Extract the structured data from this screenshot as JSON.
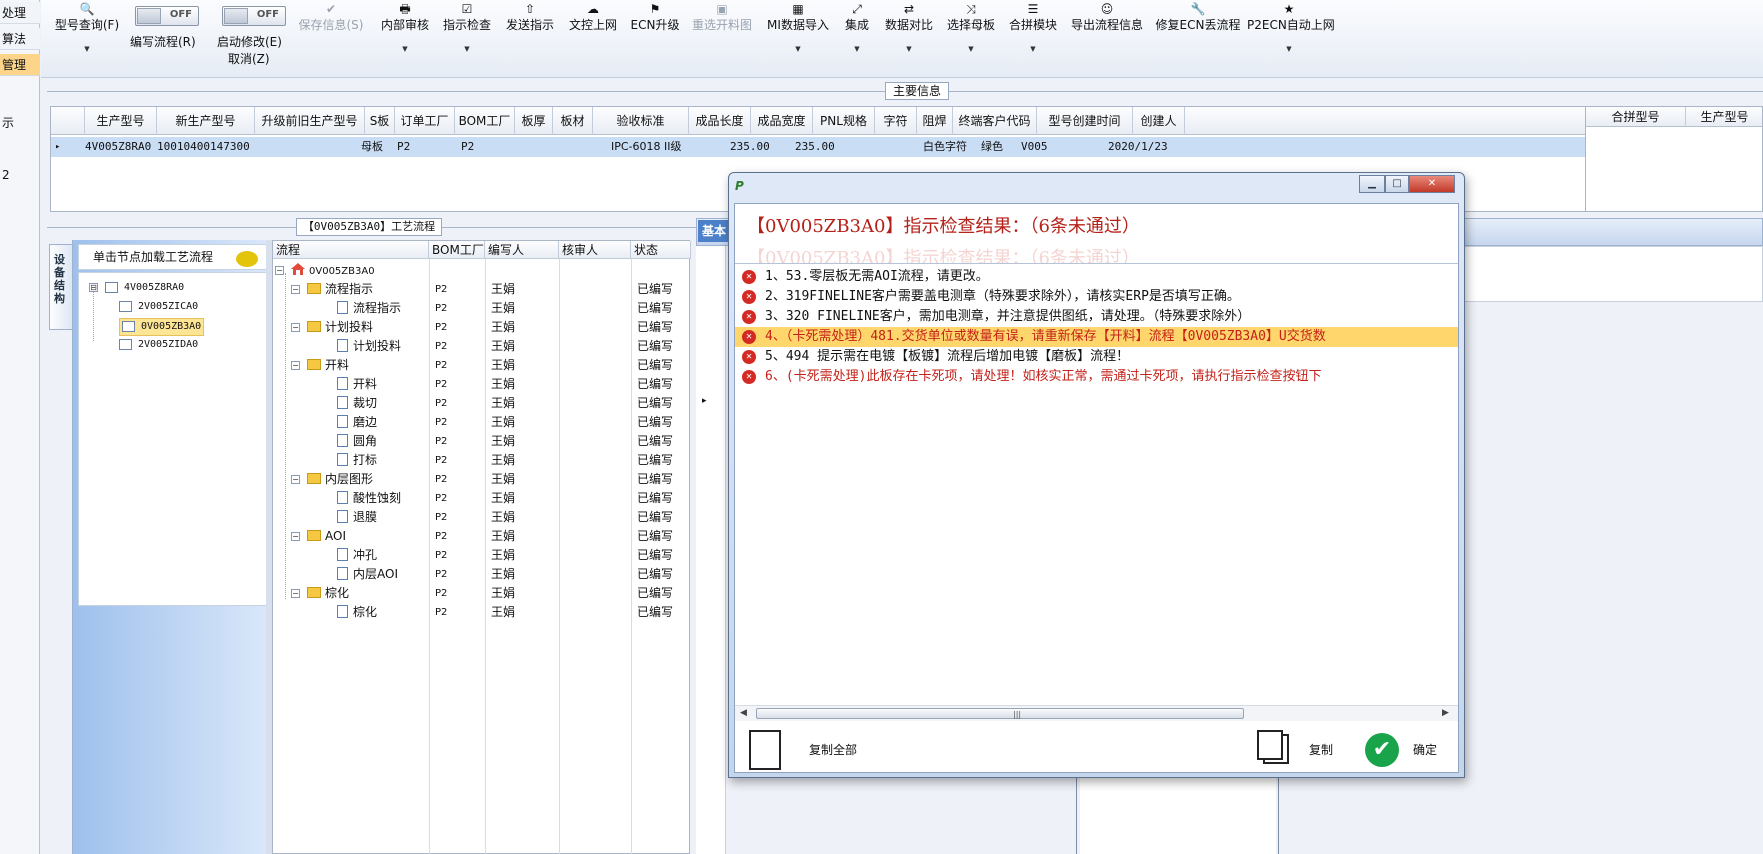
{
  "left_strip": {
    "items": [
      "处理",
      "算法",
      "管理"
    ],
    "fragments": [
      "示",
      "2"
    ]
  },
  "toolbar": {
    "buttons": [
      {
        "icon": "🔍",
        "label": "型号查询(F)",
        "arrow": "▼"
      },
      {
        "label": "编写流程(R)",
        "toggle": "OFF"
      },
      {
        "label": "启动修改(E)",
        "sub": "取消(Z)",
        "toggle": "OFF"
      },
      {
        "icon": "✔",
        "label": "保存信息(S)"
      },
      {
        "icon": "🖶",
        "label": "内部审核",
        "arrow": "▼"
      },
      {
        "icon": "☑",
        "label": "指示检查",
        "arrow": "▼"
      },
      {
        "icon": "⇧",
        "label": "发送指示"
      },
      {
        "icon": "☁",
        "label": "文控上网"
      },
      {
        "icon": "⚑",
        "label": "ECN升级"
      },
      {
        "icon": "▣",
        "label": "重选开料图"
      },
      {
        "icon": "▦",
        "label": "MI数据导入",
        "arrow": "▼"
      },
      {
        "icon": "⤢",
        "label": "集成",
        "arrow": "▼"
      },
      {
        "icon": "⇄",
        "label": "数据对比",
        "arrow": "▼"
      },
      {
        "icon": "⤨",
        "label": "选择母板",
        "arrow": "▼"
      },
      {
        "icon": "☰",
        "label": "合拼模块",
        "arrow": "▼"
      },
      {
        "icon": "☺",
        "label": "导出流程信息"
      },
      {
        "icon": "🔧",
        "label": "修复ECN丢流程"
      },
      {
        "icon": "★",
        "label": "P2ECN自动上网",
        "arrow": "▼"
      }
    ]
  },
  "main_info": {
    "title": "主要信息",
    "columns": [
      "生产型号",
      "新生产型号",
      "升级前旧生产型号",
      "S板",
      "订单工厂",
      "BOM工厂",
      "板厚",
      "板材",
      "验收标准",
      "成品长度",
      "成品宽度",
      "PNL规格",
      "字符",
      "阻焊",
      "终端客户代码",
      "型号创建时间",
      "创建人"
    ],
    "row": [
      "4V005Z8RA0",
      "10010400147300",
      "",
      "母板",
      "P2",
      "P2",
      "",
      "",
      "IPC-6018 II级",
      "235.00",
      "235.00",
      "",
      "白色字符",
      "绿色",
      "V005",
      "2020/1/23",
      ""
    ],
    "row_marker": "▸"
  },
  "merge_table": {
    "columns": [
      "合拼型号",
      "生产型号"
    ]
  },
  "flow_panel": {
    "title": "【0V005ZB3A0】工艺流程",
    "side_tab": "设备结构",
    "header": "单击节点加载工艺流程",
    "tree": [
      {
        "label": "4V005Z8RA0",
        "expander": "⊟"
      },
      {
        "label": "2V005ZICA0"
      },
      {
        "label": "0V005ZB3A0",
        "selected": true
      },
      {
        "label": "2V005ZIDA0"
      }
    ],
    "columns": [
      "流程",
      "BOM工厂",
      "编写人",
      "核审人",
      "状态"
    ],
    "rows": [
      {
        "name": "0V005ZB3A0",
        "type": "root",
        "bom": "",
        "writer": "",
        "status": ""
      },
      {
        "name": "流程指示",
        "type": "folder",
        "bom": "P2",
        "writer": "王娟",
        "status": "已编写"
      },
      {
        "name": "流程指示",
        "type": "doc",
        "bom": "P2",
        "writer": "王娟",
        "status": "已编写"
      },
      {
        "name": "计划投料",
        "type": "folder",
        "bom": "P2",
        "writer": "王娟",
        "status": "已编写"
      },
      {
        "name": "计划投料",
        "type": "doc",
        "bom": "P2",
        "writer": "王娟",
        "status": "已编写"
      },
      {
        "name": "开料",
        "type": "folder",
        "bom": "P2",
        "writer": "王娟",
        "status": "已编写"
      },
      {
        "name": "开料",
        "type": "doc",
        "bom": "P2",
        "writer": "王娟",
        "status": "已编写"
      },
      {
        "name": "裁切",
        "type": "doc",
        "bom": "P2",
        "writer": "王娟",
        "status": "已编写"
      },
      {
        "name": "磨边",
        "type": "doc",
        "bom": "P2",
        "writer": "王娟",
        "status": "已编写"
      },
      {
        "name": "圆角",
        "type": "doc",
        "bom": "P2",
        "writer": "王娟",
        "status": "已编写"
      },
      {
        "name": "打标",
        "type": "doc",
        "bom": "P2",
        "writer": "王娟",
        "status": "已编写"
      },
      {
        "name": "内层图形",
        "type": "folder",
        "bom": "P2",
        "writer": "王娟",
        "status": "已编写"
      },
      {
        "name": "酸性蚀刻",
        "type": "doc",
        "bom": "P2",
        "writer": "王娟",
        "status": "已编写"
      },
      {
        "name": "退膜",
        "type": "doc",
        "bom": "P2",
        "writer": "王娟",
        "status": "已编写"
      },
      {
        "name": "AOI",
        "type": "folder",
        "bom": "P2",
        "writer": "王娟",
        "status": "已编写"
      },
      {
        "name": "冲孔",
        "type": "doc",
        "bom": "P2",
        "writer": "王娟",
        "status": "已编写"
      },
      {
        "name": "内层AOI",
        "type": "doc",
        "bom": "P2",
        "writer": "王娟",
        "status": "已编写"
      },
      {
        "name": "棕化",
        "type": "folder",
        "bom": "P2",
        "writer": "王娟",
        "status": "已编写"
      },
      {
        "name": "棕化",
        "type": "doc",
        "bom": "P2",
        "writer": "王娟",
        "status": "已编写"
      }
    ]
  },
  "right_panel": {
    "tab": "基本",
    "row_marker": "▸"
  },
  "dialog": {
    "headline": "【0V005ZB3A0】指示检查结果：（6条未通过）",
    "ghost_text": "【0V005ZB3A0】指示检查结果：（6条未通过）",
    "error_icon": "✕",
    "messages": [
      "1、53.零层板无需AOI流程，请更改。",
      "2、319FINELINE客户需要盖电测章（特殊要求除外），请核实ERP是否填写正确。",
      "3、320 FINELINE客户，需加电测章，并注意提供图纸，请处理。（特殊要求除外）",
      "4、（卡死需处理）481.交货单位或数量有误，请重新保存【开料】流程【0V005ZB3A0】U交货数",
      "5、494 提示需在电镀【板镀】流程后增加电镀【磨板】流程！",
      "6、(卡死需处理)此板存在卡死项，请处理！如核实正常，需通过卡死项，请执行指示检查按钮下"
    ],
    "selected_index": 3,
    "copy_all_label": "复制全部",
    "copy_label": "复制",
    "ok_label": "确定",
    "ok_icon": "✔",
    "window_buttons": [
      "▁",
      "□",
      "✕"
    ],
    "scroll_left": "◀",
    "scroll_right": "▶",
    "scroll_grip": "|||"
  }
}
